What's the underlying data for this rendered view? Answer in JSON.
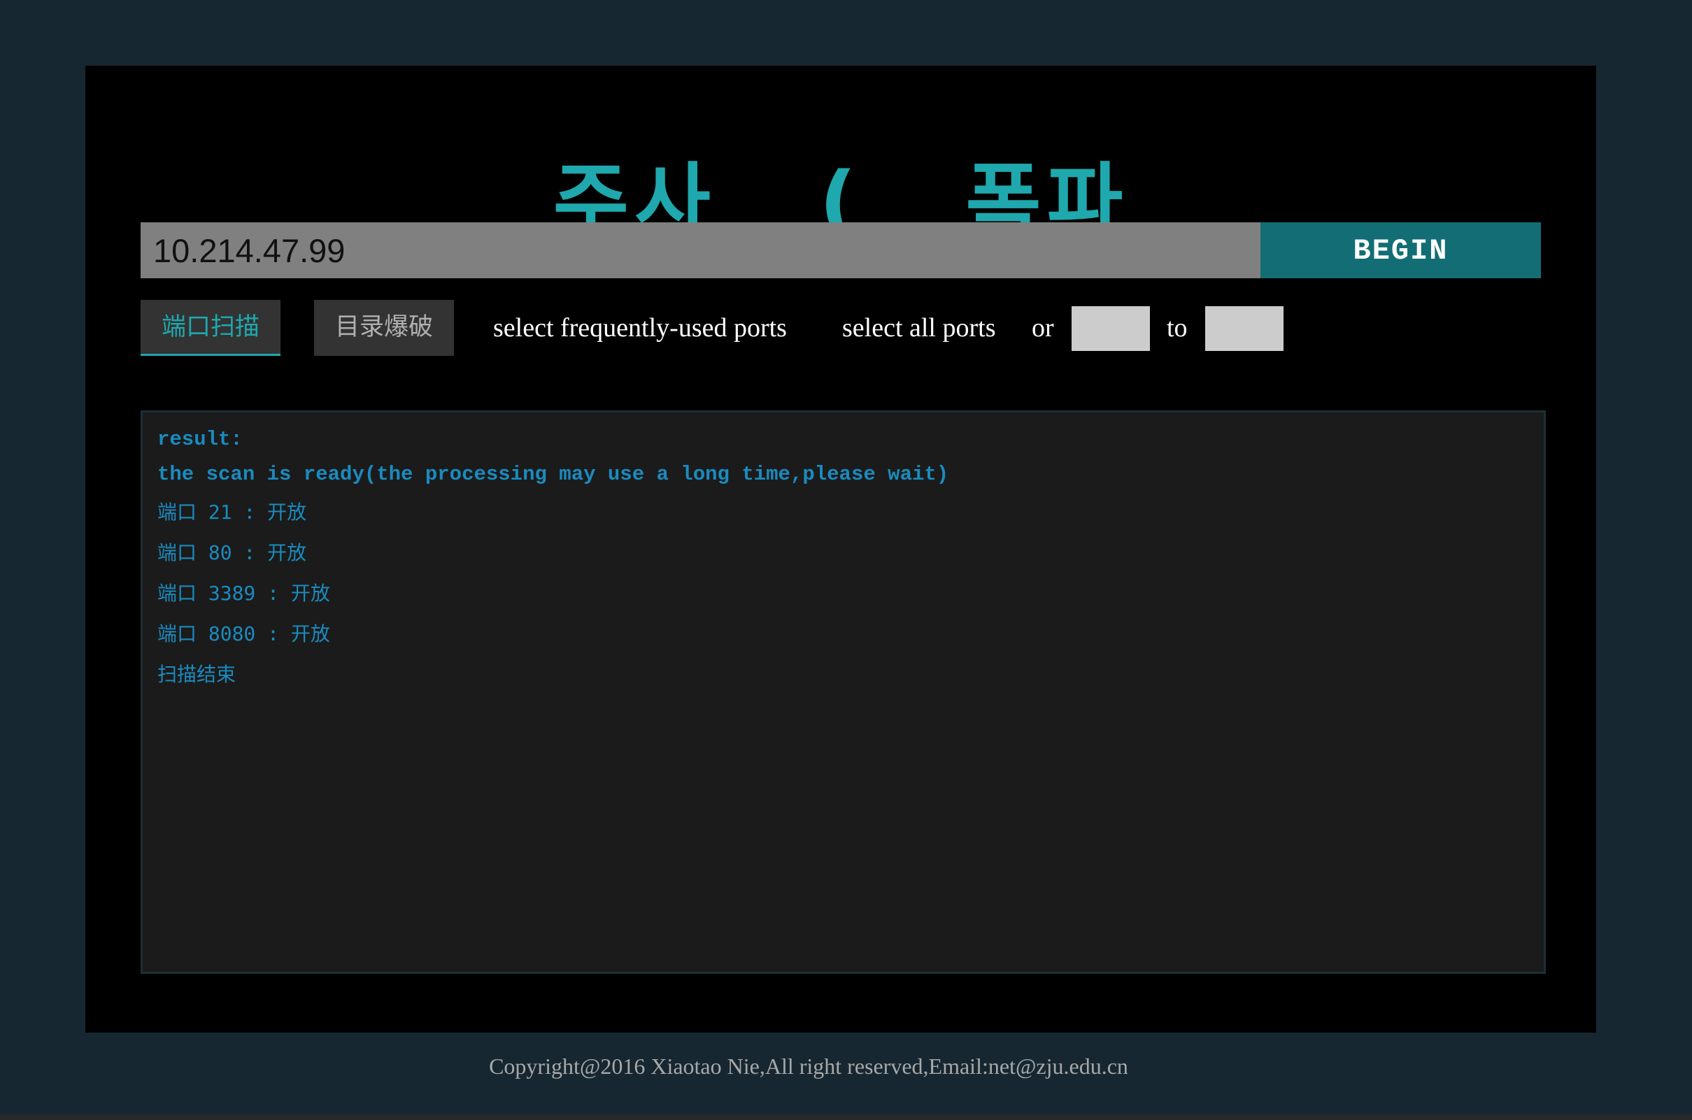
{
  "title": "주사   (   폭파",
  "target": {
    "value": "10.214.47.99",
    "placeholder": ""
  },
  "begin_label": "BEGIN",
  "tabs": [
    {
      "label": "端口扫描",
      "active": true
    },
    {
      "label": "目录爆破",
      "active": false
    }
  ],
  "options": {
    "frequent_ports": "select frequently-used ports",
    "all_ports": "select all ports",
    "or": "or",
    "to": "to",
    "port_from_value": "",
    "port_to_value": ""
  },
  "result": {
    "header": "result:",
    "status": "the scan is ready(the processing may use a long time,please wait)",
    "lines": [
      "端口 21 : 开放",
      "端口 80 : 开放",
      "端口 3389 : 开放",
      "端口 8080 : 开放",
      "扫描结束"
    ]
  },
  "footer": "Copyright@2016 Xiaotao Nie,All right reserved,Email:net@zju.edu.cn",
  "colors": {
    "accent": "#1fa8ad",
    "button": "#126e74",
    "result_text": "#1a8bbf",
    "page_bg": "#172731"
  }
}
